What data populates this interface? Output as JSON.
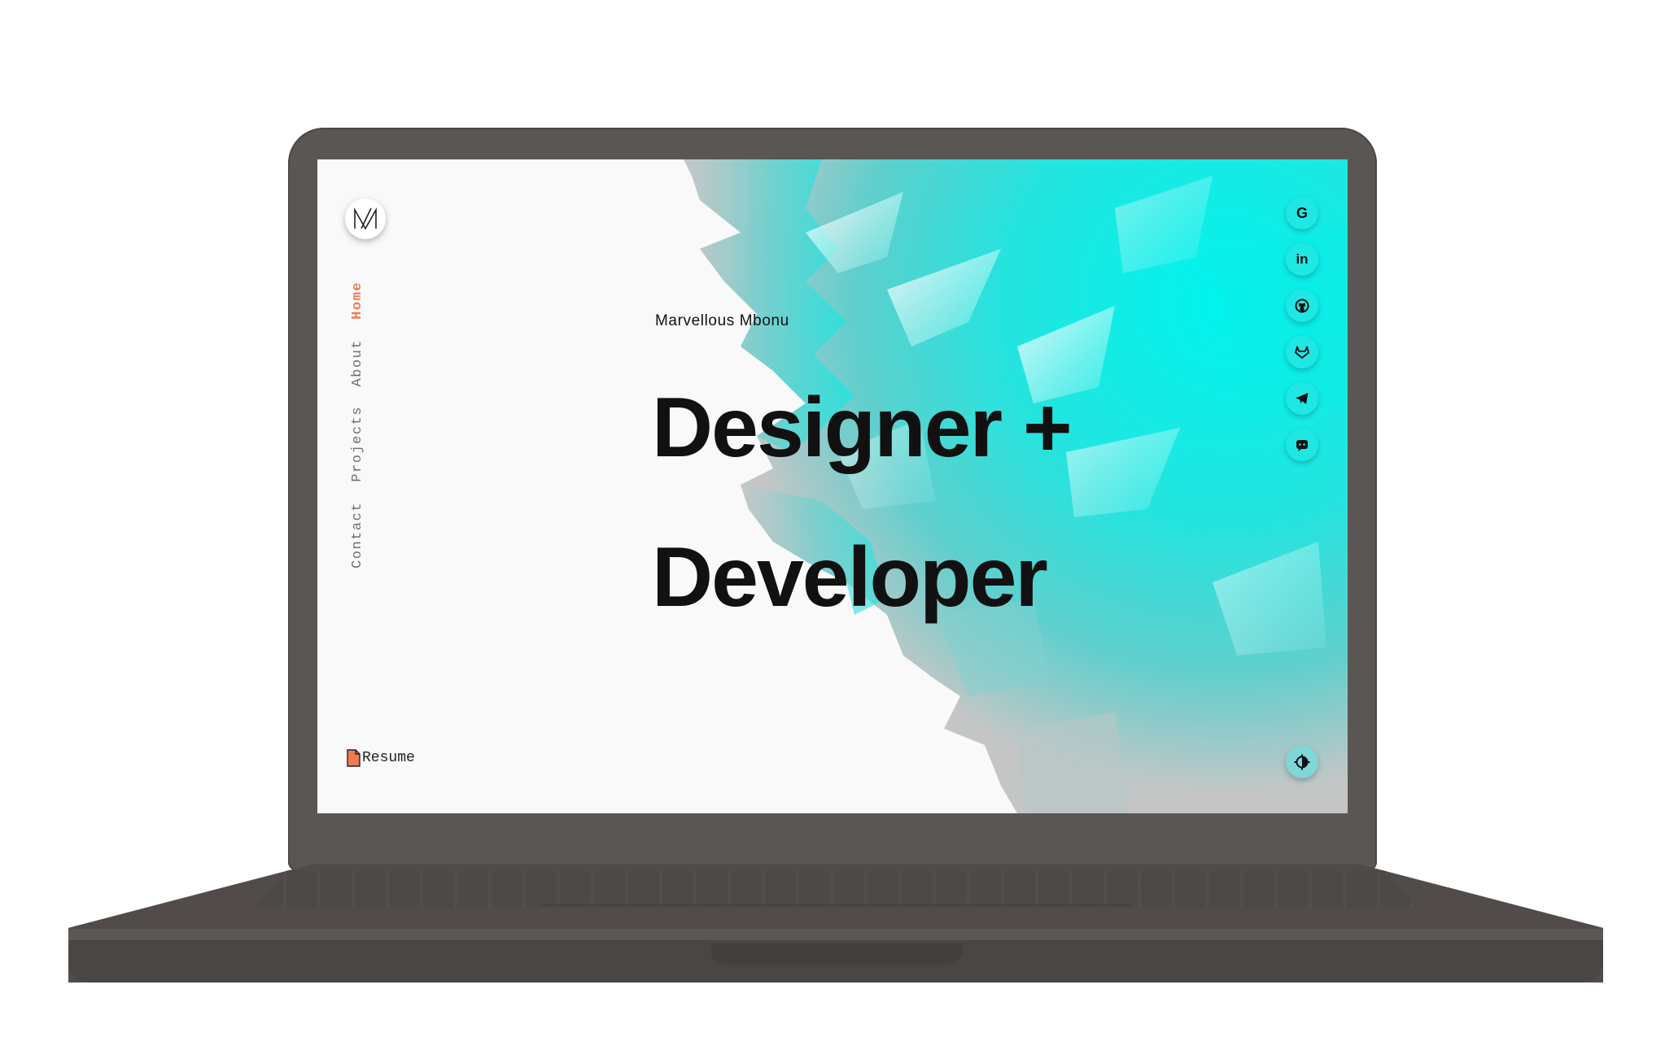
{
  "brand": {
    "logo_icon": "monogram-mm-icon"
  },
  "nav": {
    "items": [
      {
        "label": "Home",
        "active": true
      },
      {
        "label": "About",
        "active": false
      },
      {
        "label": "Projects",
        "active": false
      },
      {
        "label": "Contact",
        "active": false
      }
    ]
  },
  "hero": {
    "name": "Marvellous Mbonu",
    "headline_line1": "Designer +",
    "headline_line2": "Developer"
  },
  "resume": {
    "label": "Resume",
    "icon": "document-icon"
  },
  "social": {
    "icons": [
      "google-icon",
      "linkedin-icon",
      "github-icon",
      "gitlab-icon",
      "telegram-icon",
      "discord-icon"
    ],
    "google_glyph": "G",
    "linkedin_glyph": "in"
  },
  "theme_toggle": {
    "icon": "theme-toggle-icon"
  },
  "colors": {
    "accent": "#f07a52",
    "social_bg": "#1fe8e4",
    "screen_bg": "#f9f9f9",
    "art_cyan": "#00f0ea",
    "art_teal": "#2fc6c4",
    "art_gray": "#bdbdbd",
    "laptop_body": "#5a5654"
  }
}
